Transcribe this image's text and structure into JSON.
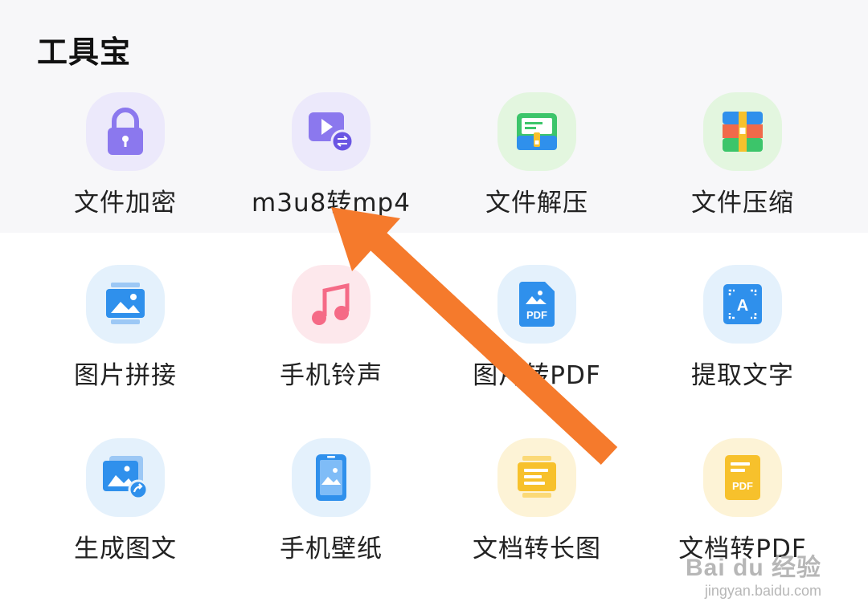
{
  "section": {
    "title": "工具宝"
  },
  "tools": [
    {
      "label": "文件加密",
      "icon": "lock-icon",
      "tile_color": "#ece9fb"
    },
    {
      "label": "m3u8转mp4",
      "icon": "video-convert-icon",
      "tile_color": "#ece9fb"
    },
    {
      "label": "文件解压",
      "icon": "unzip-icon",
      "tile_color": "#e3f6df"
    },
    {
      "label": "文件压缩",
      "icon": "archive-icon",
      "tile_color": "#e3f6df"
    },
    {
      "label": "图片拼接",
      "icon": "image-stitch-icon",
      "tile_color": "#e4f1fc"
    },
    {
      "label": "手机铃声",
      "icon": "music-note-icon",
      "tile_color": "#fde8ec"
    },
    {
      "label": "图片转PDF",
      "icon": "image-pdf-icon",
      "tile_color": "#e4f1fc"
    },
    {
      "label": "提取文字",
      "icon": "text-extract-icon",
      "tile_color": "#e4f1fc"
    },
    {
      "label": "生成图文",
      "icon": "image-text-icon",
      "tile_color": "#e4f1fc"
    },
    {
      "label": "手机壁纸",
      "icon": "phone-wallpaper-icon",
      "tile_color": "#e4f1fc"
    },
    {
      "label": "文档转长图",
      "icon": "doc-long-image-icon",
      "tile_color": "#fdf3d6"
    },
    {
      "label": "文档转PDF",
      "icon": "doc-pdf-icon",
      "tile_color": "#fdf3d6"
    }
  ],
  "icon_texts": {
    "pdf": "PDF",
    "letter_a": "A"
  },
  "colors": {
    "arrow": "#f57a2c",
    "purple": "#8b78ee",
    "green": "#3cc56a",
    "blue": "#2f90ec",
    "pink": "#f56a86",
    "yellow": "#f7c12c"
  },
  "watermark": {
    "logo": "Bai du 经验",
    "url": "jingyan.baidu.com"
  }
}
